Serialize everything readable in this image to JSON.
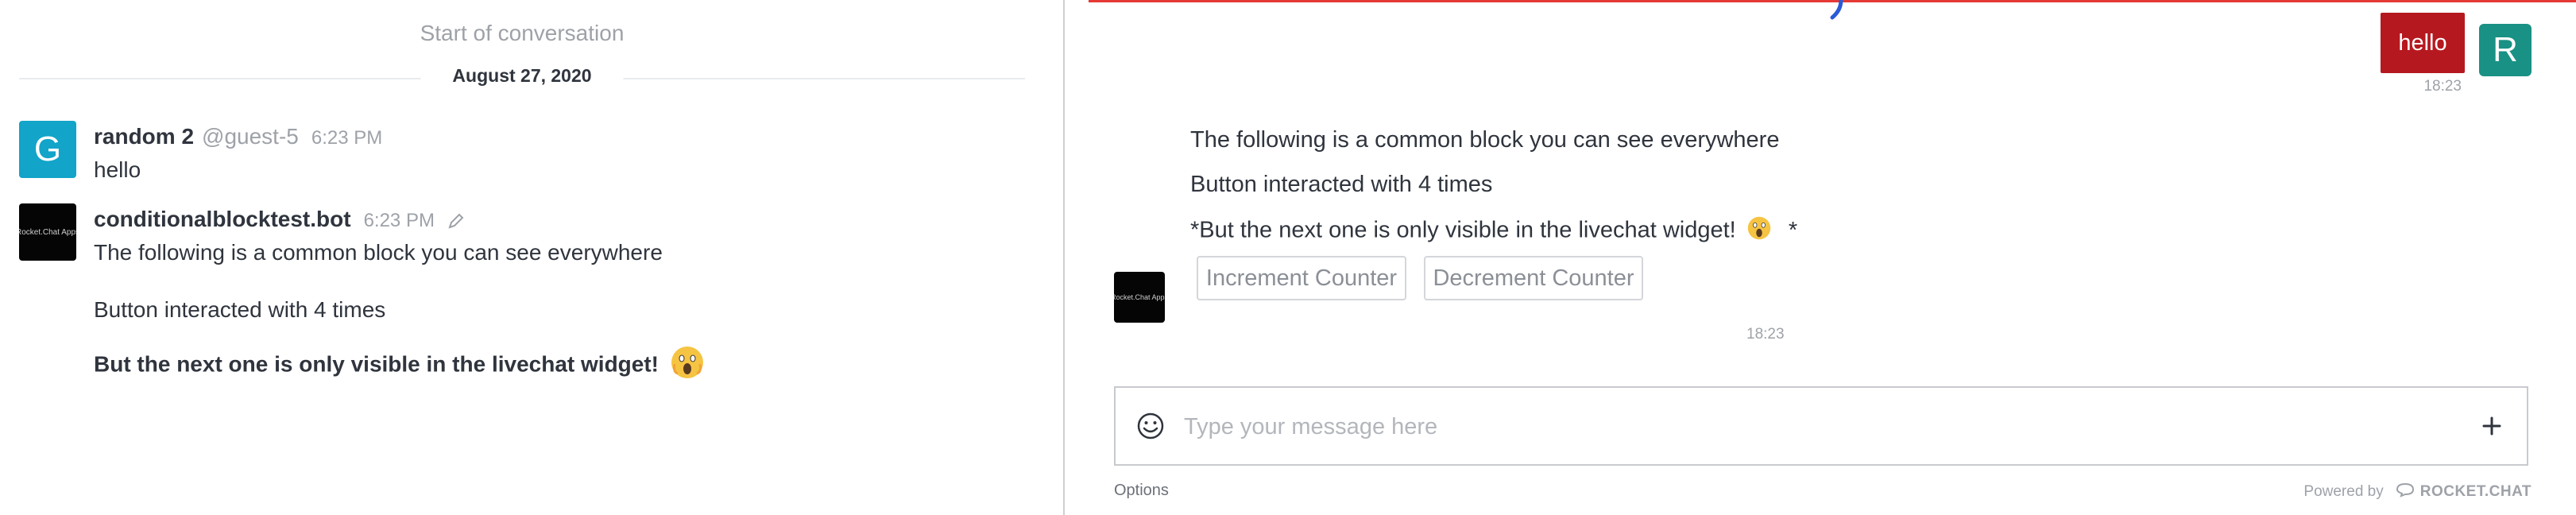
{
  "room": {
    "start_label": "Start of conversation",
    "date_label": "August 27, 2020",
    "messages": [
      {
        "avatar_letter": "G",
        "name": "random 2",
        "username": "@guest-5",
        "time": "6:23 PM",
        "text": "hello"
      },
      {
        "avatar_text": "Rocket.Chat Apps",
        "name": "conditionalblocktest.bot",
        "time": "6:23 PM",
        "lines": [
          "The following is a common block you can see everywhere",
          "Button interacted with 4 times",
          "But the next one is only visible in the livechat widget!"
        ]
      }
    ]
  },
  "livechat": {
    "visitor_message": "hello",
    "visitor_avatar_letter": "R",
    "visitor_time": "18:23",
    "bot_avatar_text": "Rocket.Chat Apps",
    "bot_lines": [
      "The following is a common block you can see everywhere",
      "Button interacted with 4 times",
      "*But the next one is only visible in the livechat widget!",
      "*"
    ],
    "buttons": [
      "Increment Counter",
      "Decrement Counter"
    ],
    "bot_time": "18:23",
    "composer_placeholder": "Type your message here",
    "options_label": "Options",
    "powered_by": "Powered by",
    "brand": "ROCKET.CHAT"
  },
  "colors": {
    "guest_avatar": "#12a4c9",
    "visitor_bubble": "#b5191f",
    "visitor_avatar": "#199184",
    "top_bar": "#e53935"
  },
  "icons": [
    "edit-pencil-icon",
    "scream-emoji-icon",
    "loading-spinner-icon",
    "smile-icon",
    "plus-icon",
    "rocketchat-logo-icon"
  ]
}
